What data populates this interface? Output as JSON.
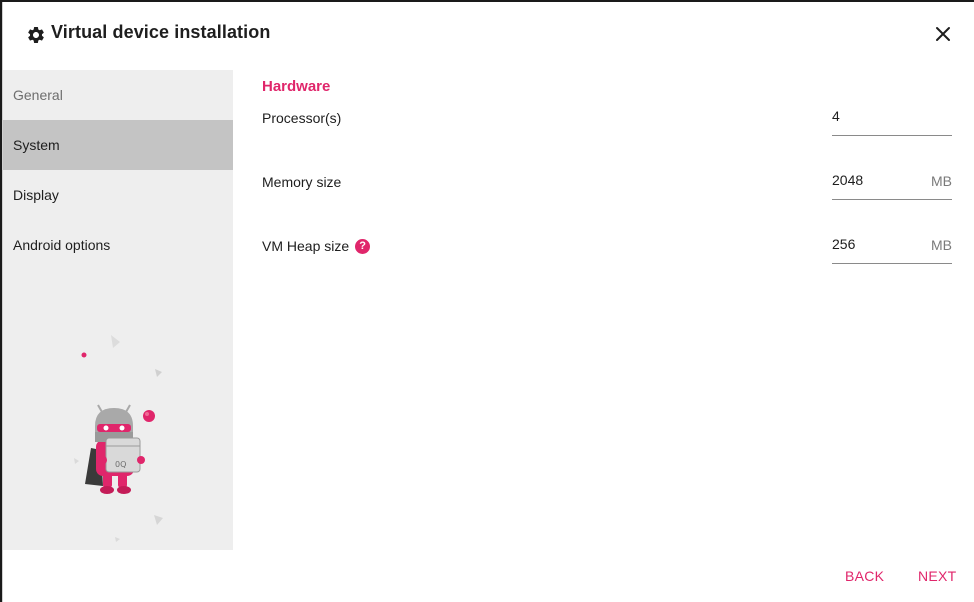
{
  "dialog": {
    "title": "Virtual device installation",
    "title_icon": "gear-icon",
    "close_icon": "close-icon"
  },
  "sidebar": {
    "items": [
      {
        "label": "General",
        "state": "visited"
      },
      {
        "label": "System",
        "state": "active"
      },
      {
        "label": "Display",
        "state": "default"
      },
      {
        "label": "Android options",
        "state": "default"
      }
    ]
  },
  "hardware": {
    "section_title": "Hardware",
    "processors": {
      "label": "Processor(s)",
      "value": "4"
    },
    "memory": {
      "label": "Memory size",
      "value": "2048",
      "unit": "MB"
    },
    "vm_heap": {
      "label": "VM Heap size",
      "value": "256",
      "unit": "MB",
      "help_icon": "question-icon"
    }
  },
  "footer": {
    "back_label": "BACK",
    "next_label": "NEXT"
  },
  "colors": {
    "accent": "#e0266b",
    "sidebar_bg": "#eeeeee",
    "sidebar_active": "#c4c4c4"
  }
}
